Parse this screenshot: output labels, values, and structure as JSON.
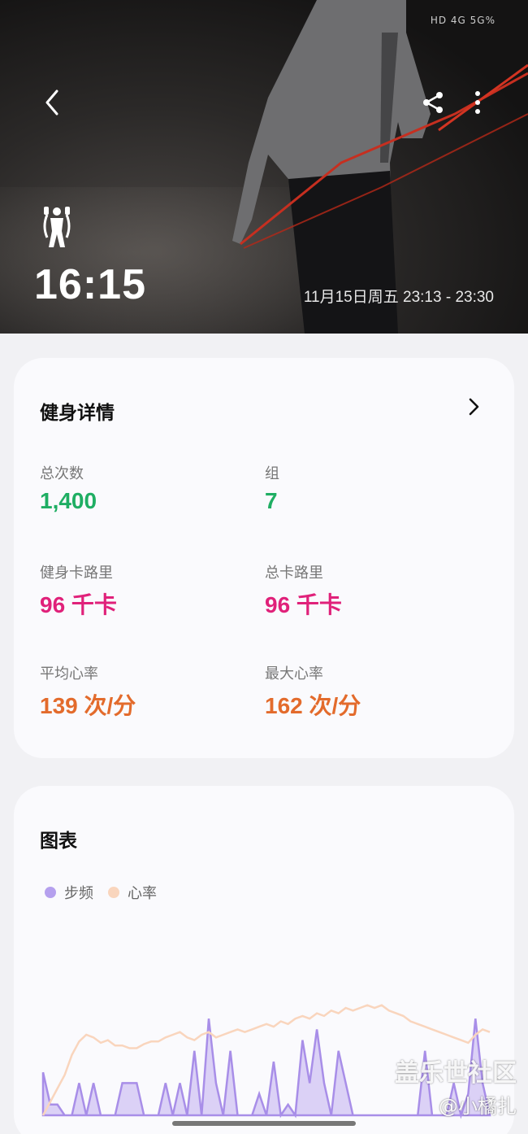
{
  "status_bar": {
    "text": "HD 4G 5G% "
  },
  "hero": {
    "duration": "16:15",
    "date_range": "11月15日周五 23:13 - 23:30",
    "sport_icon": "jump-rope-icon"
  },
  "details": {
    "title": "健身详情",
    "stats": [
      {
        "label": "总次数",
        "value": "1,400",
        "color": "#1fae63"
      },
      {
        "label": "组",
        "value": "7",
        "color": "#1fae63"
      },
      {
        "label": "健身卡路里",
        "value": "96 千卡",
        "color": "#e0217a"
      },
      {
        "label": "总卡路里",
        "value": "96 千卡",
        "color": "#e0217a"
      },
      {
        "label": "平均心率",
        "value": "139 次/分",
        "color": "#e36b2c"
      },
      {
        "label": "最大心率",
        "value": "162 次/分",
        "color": "#e36b2c"
      }
    ]
  },
  "chart": {
    "title": "图表",
    "legend": [
      {
        "name": "步频",
        "color": "#b5a0ee"
      },
      {
        "name": "心率",
        "color": "#f9d5bd"
      }
    ]
  },
  "chart_data": {
    "type": "area",
    "series": [
      {
        "name": "步频",
        "values": [
          20,
          5,
          5,
          0,
          0,
          15,
          0,
          15,
          0,
          0,
          0,
          15,
          15,
          15,
          0,
          0,
          0,
          15,
          0,
          15,
          0,
          30,
          0,
          45,
          15,
          0,
          30,
          0,
          0,
          0,
          10,
          0,
          25,
          0,
          5,
          0,
          35,
          15,
          40,
          15,
          0,
          30,
          15,
          0,
          0,
          0,
          0,
          0,
          0,
          0,
          0,
          0,
          0,
          30,
          0,
          0,
          0,
          15,
          0,
          10,
          45,
          15,
          0
        ]
      },
      {
        "name": "心率",
        "values": [
          0,
          10,
          20,
          30,
          45,
          55,
          60,
          58,
          54,
          56,
          52,
          52,
          50,
          50,
          53,
          55,
          55,
          58,
          60,
          62,
          58,
          56,
          60,
          62,
          58,
          60,
          62,
          64,
          62,
          64,
          66,
          68,
          66,
          70,
          68,
          72,
          74,
          72,
          76,
          74,
          78,
          76,
          80,
          78,
          80,
          82,
          80,
          82,
          78,
          76,
          74,
          70,
          68,
          66,
          64,
          62,
          60,
          58,
          56,
          54,
          60,
          64,
          62
        ]
      }
    ]
  },
  "watermark": {
    "line1": "盖乐世社区",
    "line2": "@小橘扎"
  }
}
